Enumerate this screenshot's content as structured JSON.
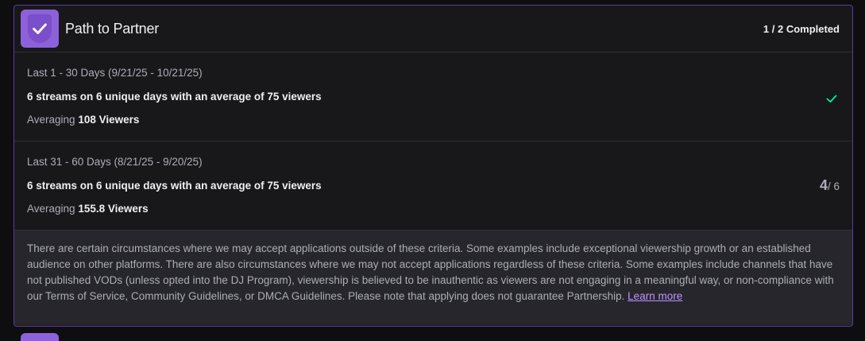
{
  "header": {
    "title": "Path to Partner",
    "progress": "1 / 2 Completed"
  },
  "criteria": [
    {
      "period": "Last 1 - 30 Days (9/21/25 - 10/21/25)",
      "requirement": "6 streams on 6 unique days with an average of 75 viewers",
      "average_prefix": "Averaging",
      "average_value": "108 Viewers",
      "status": "completed"
    },
    {
      "period": "Last 31 - 60 Days (8/21/25 - 9/20/25)",
      "requirement": "6 streams on 6 unique days with an average of 75 viewers",
      "average_prefix": "Averaging",
      "average_value": "155.8 Viewers",
      "streams_done": "4",
      "streams_total": "/ 6"
    }
  ],
  "footnote": {
    "text": "There are certain circumstances where we may accept applications outside of these criteria. Some examples include exceptional viewership growth or an established audience on other platforms. There are also circumstances where we may not accept applications regardless of these criteria. Some examples include channels that have not published VODs (unless opted into the DJ Program), viewership is believed to be inauthentic as viewers are not engaging in a meaningful way, or non-compliance with our Terms of Service, Community Guidelines, or DMCA Guidelines. Please note that applying does not guarantee Partnership.",
    "link": "Learn more"
  },
  "colors": {
    "accent": "#8d61d9",
    "success": "#00f593",
    "link": "#bf94ff",
    "border": "#5c3a9e"
  },
  "icons": {
    "badge": "shield-check-icon",
    "completed": "checkmark-icon"
  }
}
